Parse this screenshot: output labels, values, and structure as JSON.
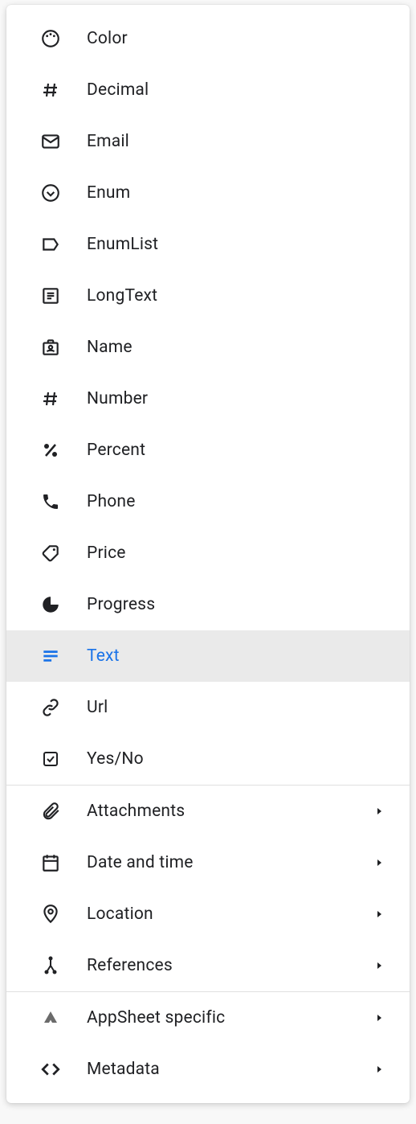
{
  "menu": {
    "groups": [
      [
        {
          "id": "color",
          "label": "Color",
          "icon": "palette-icon",
          "selected": false,
          "sub": false
        },
        {
          "id": "decimal",
          "label": "Decimal",
          "icon": "hash-icon",
          "selected": false,
          "sub": false
        },
        {
          "id": "email",
          "label": "Email",
          "icon": "mail-icon",
          "selected": false,
          "sub": false
        },
        {
          "id": "enum",
          "label": "Enum",
          "icon": "enum-icon",
          "selected": false,
          "sub": false
        },
        {
          "id": "enumlist",
          "label": "EnumList",
          "icon": "label-icon",
          "selected": false,
          "sub": false
        },
        {
          "id": "longtext",
          "label": "LongText",
          "icon": "longtext-icon",
          "selected": false,
          "sub": false
        },
        {
          "id": "name",
          "label": "Name",
          "icon": "badge-icon",
          "selected": false,
          "sub": false
        },
        {
          "id": "number",
          "label": "Number",
          "icon": "hash-icon",
          "selected": false,
          "sub": false
        },
        {
          "id": "percent",
          "label": "Percent",
          "icon": "percent-icon",
          "selected": false,
          "sub": false
        },
        {
          "id": "phone",
          "label": "Phone",
          "icon": "phone-icon",
          "selected": false,
          "sub": false
        },
        {
          "id": "price",
          "label": "Price",
          "icon": "tag-icon",
          "selected": false,
          "sub": false
        },
        {
          "id": "progress",
          "label": "Progress",
          "icon": "progress-icon",
          "selected": false,
          "sub": false
        },
        {
          "id": "text",
          "label": "Text",
          "icon": "text-icon",
          "selected": true,
          "sub": false
        },
        {
          "id": "url",
          "label": "Url",
          "icon": "link-icon",
          "selected": false,
          "sub": false
        },
        {
          "id": "yesno",
          "label": "Yes/No",
          "icon": "checkbox-icon",
          "selected": false,
          "sub": false
        }
      ],
      [
        {
          "id": "attachments",
          "label": "Attachments",
          "icon": "attachment-icon",
          "selected": false,
          "sub": true
        },
        {
          "id": "datetime",
          "label": "Date and time",
          "icon": "calendar-icon",
          "selected": false,
          "sub": true
        },
        {
          "id": "location",
          "label": "Location",
          "icon": "location-icon",
          "selected": false,
          "sub": true
        },
        {
          "id": "references",
          "label": "References",
          "icon": "merge-icon",
          "selected": false,
          "sub": true
        }
      ],
      [
        {
          "id": "appsheet",
          "label": "AppSheet specific",
          "icon": "appsheet-icon",
          "selected": false,
          "sub": true
        },
        {
          "id": "metadata",
          "label": "Metadata",
          "icon": "code-icon",
          "selected": false,
          "sub": true
        }
      ]
    ]
  },
  "colors": {
    "accent": "#1a73e8",
    "text": "#202124"
  }
}
